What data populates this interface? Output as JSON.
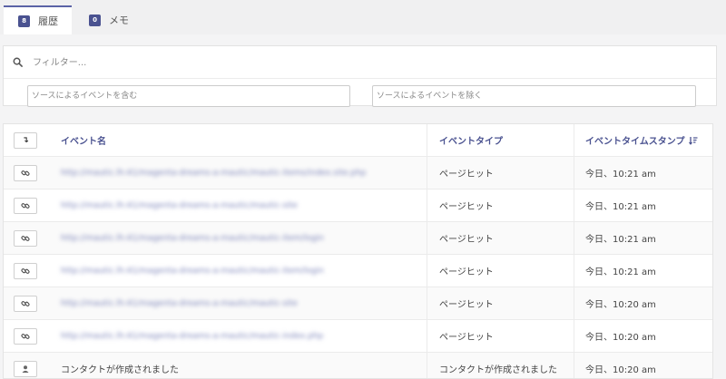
{
  "tabs": [
    {
      "badge": "8",
      "label": "履歴"
    },
    {
      "badge": "0",
      "label": "メモ"
    }
  ],
  "filter": {
    "placeholder": "フィルター...",
    "include_placeholder": "ソースによるイベントを含む",
    "exclude_placeholder": "ソースによるイベントを除く"
  },
  "table": {
    "headers": {
      "sort_button": "↴",
      "name": "イベント名",
      "type": "イベントタイプ",
      "time": "イベントタイムスタンプ"
    },
    "rows": [
      {
        "icon": "link-icon",
        "name": "http://mautic.lh:41/magenta-dreams-a-mautic/mautic-items/index.site.php",
        "type": "ページヒット",
        "time": "今日、10:21 am"
      },
      {
        "icon": "link-icon",
        "name": "http://mautic.lh:41/magenta-dreams-a-mautic/mautic-site",
        "type": "ページヒット",
        "time": "今日、10:21 am"
      },
      {
        "icon": "link-icon",
        "name": "http://mautic.lh:41/magenta-dreams-a-mautic/mautic-item/login",
        "type": "ページヒット",
        "time": "今日、10:21 am"
      },
      {
        "icon": "link-icon",
        "name": "http://mautic.lh:41/magenta-dreams-a-mautic/mautic-item/login",
        "type": "ページヒット",
        "time": "今日、10:21 am"
      },
      {
        "icon": "link-icon",
        "name": "http://mautic.lh:41/magenta-dreams-a-mautic/mautic-site",
        "type": "ページヒット",
        "time": "今日、10:20 am"
      },
      {
        "icon": "link-icon",
        "name": "http://mautic.lh:41/magenta-dreams-a-mautic/mautic-index.php",
        "type": "ページヒット",
        "time": "今日、10:20 am"
      },
      {
        "icon": "user-icon",
        "name": "コンタクトが作成されました",
        "type": "コンタクトが作成されました",
        "time": "今日、10:20 am"
      }
    ]
  },
  "colors": {
    "accent": "#4a5290",
    "link_blur": "#7a82b8"
  }
}
